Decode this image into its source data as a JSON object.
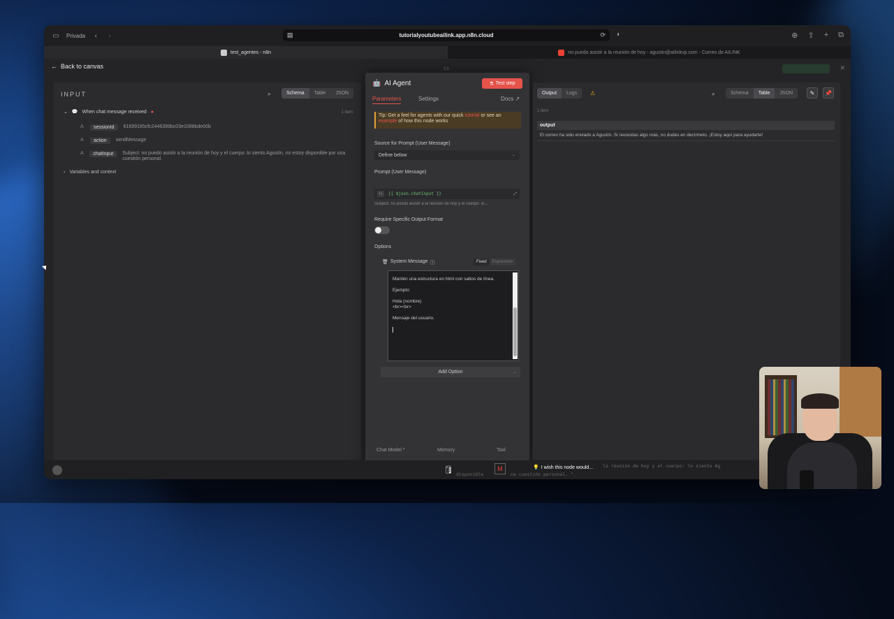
{
  "browser": {
    "mode_label": "Privada",
    "url": "tutorialyoutubeailink.app.n8n.cloud",
    "tab_active": "test_agentes - n8n",
    "tab_inactive": "no puedo asistir a la reunión de hoy - agustin@ailinkvp.com - Correo de AILINK"
  },
  "canvas": {
    "back_label": "Back to canvas"
  },
  "input_panel": {
    "title": "INPUT",
    "view_options": [
      "Schema",
      "Table",
      "JSON"
    ],
    "active_view": "Schema",
    "root_label": "When chat message received",
    "item_count": "1 item",
    "fields": [
      {
        "type": "A",
        "name": "sessionId",
        "value": "61699185cfc2446399bc03e1088bde00b"
      },
      {
        "type": "A",
        "name": "action",
        "value": "sendMessage"
      },
      {
        "type": "A",
        "name": "chatInput",
        "value": "Subject: no puedo asistir a la reunión de hoy y el cuerpo: lo siento Agustín, no estoy disponible por una cuestión personal."
      }
    ],
    "variables_label": "Variables and context"
  },
  "node_panel": {
    "title": "AI Agent",
    "test_button": "Test step",
    "tabs": {
      "parameters": "Parameters",
      "settings": "Settings",
      "docs": "Docs"
    },
    "tip": {
      "prefix": "Tip: Get a feel for agents with our quick",
      "link1": "tutorial",
      "middle": "or see an",
      "link2": "example",
      "suffix": "of how this node works"
    },
    "source_label": "Source for Prompt (User Message)",
    "source_value": "Define below",
    "prompt_label": "Prompt (User Message)",
    "prompt_expression": "{{ $json.chatInput }}",
    "prompt_hint": "Subject: no puedo asistir a la reunión de hoy y el cuerpo: lo...",
    "output_format_label": "Require Specific Output Format",
    "options_label": "Options",
    "system_message_label": "System Message",
    "fixed_label": "Fixed",
    "expression_label": "Expression",
    "system_message_lines": [
      "Mantén una estructura en html con saltos de línea.",
      "Ejemplo:",
      "Hola (nombre)\n<br><br>",
      "Mensaje del usuario."
    ],
    "add_option_label": "Add Option",
    "subnodes": [
      "Chat Model *",
      "Memory",
      "Tool"
    ]
  },
  "output_panel": {
    "tabs": [
      "Output",
      "Logs"
    ],
    "active_tab": "Output",
    "view_options": [
      "Schema",
      "Table",
      "JSON"
    ],
    "active_view": "Table",
    "item_count": "1 item",
    "column": "output",
    "value": "El correo ha sido enviado a Agustín. Si necesitas algo más, no dudes en decírmelo. ¡Estoy aquí para ayudarte!"
  },
  "chat_bar": {
    "tooltip": "I wish this node would...",
    "faded_text": "la reunión de hoy y el cuerpo: lo siento Ag",
    "faded_text2": "disponible",
    "faded_text3": "na cuestión personal. \"."
  },
  "colors": {
    "accent": "#e5534b",
    "tip_border": "#e0a23a",
    "expression_green": "#6fbf73"
  }
}
